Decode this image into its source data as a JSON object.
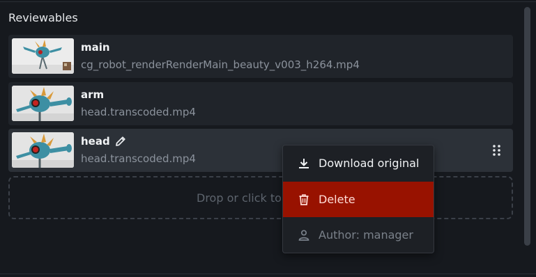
{
  "panel": {
    "title": "Reviewables"
  },
  "reviewables": [
    {
      "name": "main",
      "file": "cg_robot_renderRenderMain_beauty_v003_h264.mp4",
      "active": false
    },
    {
      "name": "arm",
      "file": "head.transcoded.mp4",
      "active": false
    },
    {
      "name": "head",
      "file": "head.transcoded.mp4",
      "active": true
    }
  ],
  "dropzone": {
    "text": "Drop or click to"
  },
  "context_menu": {
    "items": [
      {
        "label": "Download original",
        "icon": "download-icon",
        "enabled": true
      },
      {
        "label": "Delete",
        "icon": "trash-icon",
        "enabled": true,
        "highlighted": true
      },
      {
        "label": "Author: manager",
        "icon": "person-icon",
        "enabled": false
      }
    ]
  },
  "colors": {
    "background": "#16191e",
    "card": "#20242a",
    "card_active": "#2c3138",
    "delete_bg": "#981200",
    "muted_text": "#8b929c"
  }
}
